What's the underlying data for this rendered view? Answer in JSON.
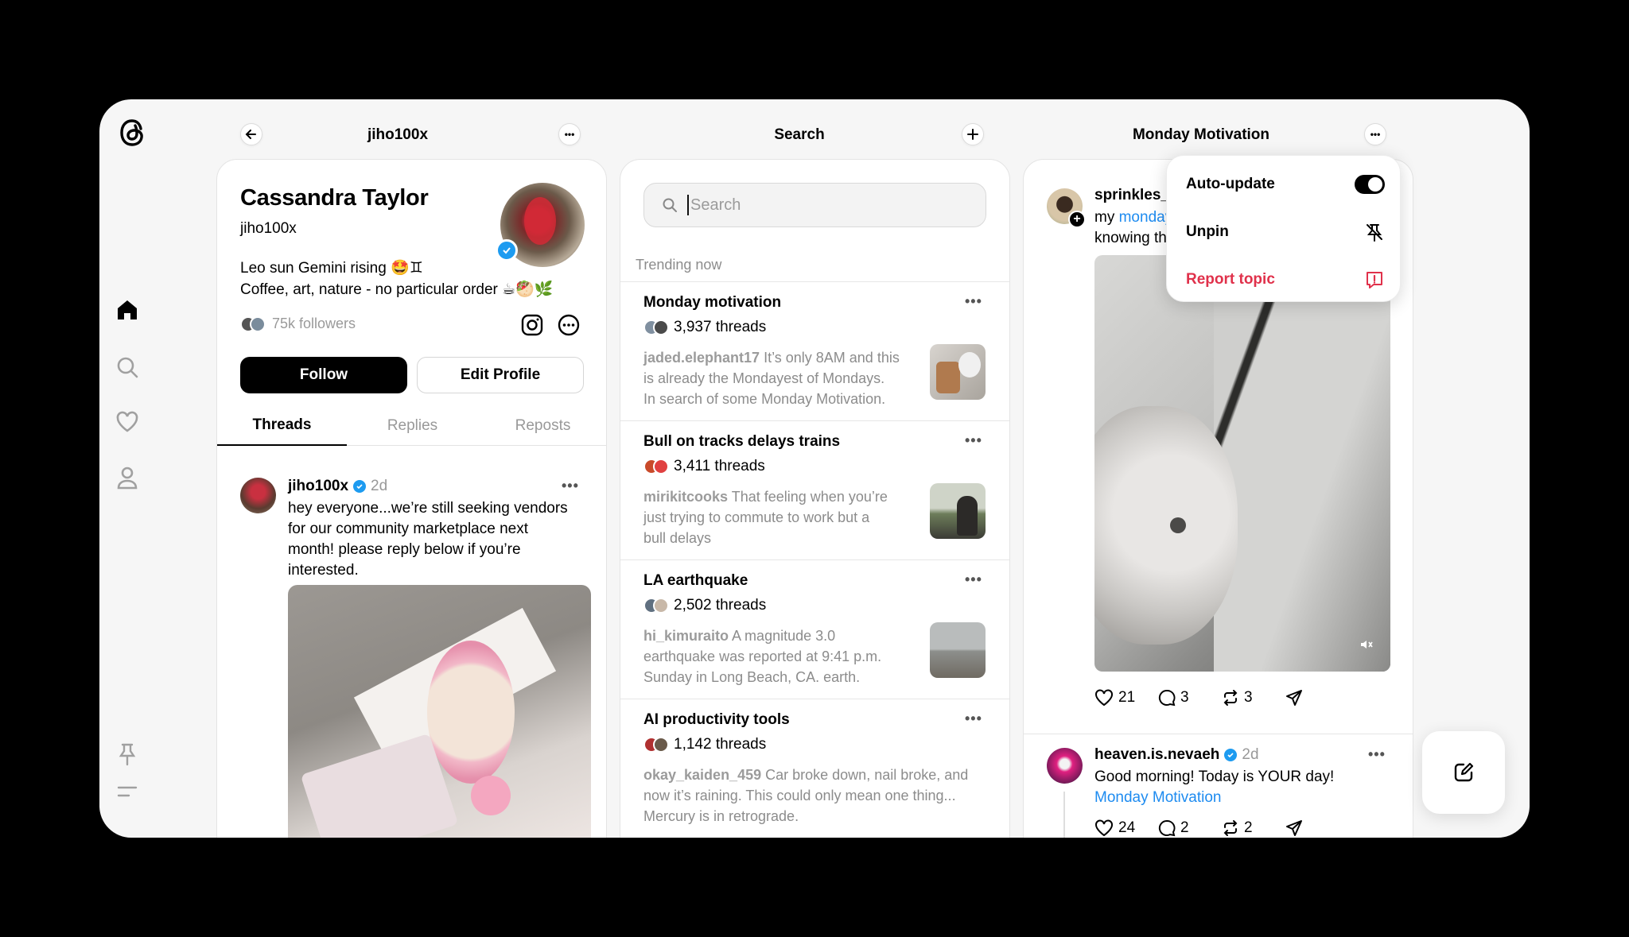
{
  "app": {
    "accent": "#000000",
    "link_color": "#1d8bf0",
    "danger_color": "#e0314b"
  },
  "columns": {
    "profile": {
      "title": "jiho100x"
    },
    "search": {
      "title": "Search"
    },
    "topic": {
      "title": "Monday Motivation"
    }
  },
  "rail": {
    "icons": [
      "threads-logo-icon",
      "home-icon",
      "search-icon",
      "heart-icon",
      "profile-icon",
      "pin-icon",
      "menu-icon"
    ]
  },
  "profile": {
    "name": "Cassandra Taylor",
    "handle": "jiho100x",
    "bio_line1": "Leo sun Gemini rising 🤩♊",
    "bio_line2": "Coffee, art, nature - no particular order ☕🥙🌿",
    "followers": "75k followers",
    "follow_label": "Follow",
    "edit_label": "Edit Profile",
    "tabs": [
      "Threads",
      "Replies",
      "Reposts"
    ],
    "post": {
      "user": "jiho100x",
      "time": "2d",
      "text": [
        "hey everyone...we’re still seeking vendors",
        "for our community marketplace next",
        "month! please reply below if you’re",
        "interested."
      ]
    }
  },
  "search": {
    "placeholder": "Search",
    "trending_label": "Trending now",
    "trends": [
      {
        "title": "Monday motivation",
        "count": "3,937 threads",
        "user": "jaded.elephant17",
        "lines": [
          "It’s only 8AM and this",
          "is already the Mondayest of Mondays.",
          "In search of some Monday Motivation."
        ]
      },
      {
        "title": "Bull on tracks delays trains",
        "count": "3,411 threads",
        "user": "mirikitcooks",
        "lines": [
          "That feeling when you’re",
          "just trying to commute to work but a",
          "bull delays"
        ]
      },
      {
        "title": "LA earthquake",
        "count": "2,502 threads",
        "user": "hi_kimuraito",
        "lines": [
          "A magnitude 3.0",
          "earthquake was reported at 9:41 p.m.",
          "Sunday in Long Beach, CA. earth."
        ]
      },
      {
        "title": "AI productivity tools",
        "count": "1,142 threads",
        "user": "okay_kaiden_459",
        "lines": [
          "Car broke down, nail broke, and",
          "now it’s raining. This could only mean one thing...",
          "Mercury is in retrograde."
        ]
      }
    ]
  },
  "topic": {
    "post1": {
      "user": "sprinkles_b",
      "line1_prefix": "my",
      "line1_link": "monday",
      "line2": "knowing th",
      "likes": "21",
      "replies": "3",
      "reposts": "3"
    },
    "post2": {
      "user": "heaven.is.nevaeh",
      "time": "2d",
      "text": "Good morning! Today is YOUR day!",
      "link": "Monday Motivation",
      "likes": "24",
      "replies": "2",
      "reposts": "2"
    },
    "menu": {
      "auto_update": "Auto-update",
      "unpin": "Unpin",
      "report": "Report topic"
    }
  }
}
